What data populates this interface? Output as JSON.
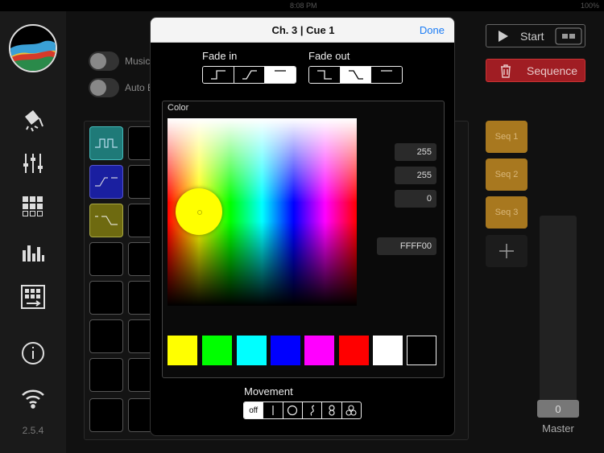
{
  "status": {
    "time": "8:08 PM",
    "battery": "100%"
  },
  "app": {
    "version": "2.5.4"
  },
  "main": {
    "music_toggle_label": "Music",
    "auto_toggle_label": "Auto B",
    "start_label": "Start",
    "sequence_label": "Sequence",
    "seq_buttons": [
      "Seq 1",
      "Seq 2",
      "Seq 3"
    ],
    "master_value": "0",
    "master_label": "Master"
  },
  "modal": {
    "title": "Ch. 3 | Cue 1",
    "done_label": "Done",
    "fade_in_label": "Fade in",
    "fade_out_label": "Fade out",
    "color_label": "Color",
    "rgb": {
      "r": "255",
      "g": "255",
      "b": "0"
    },
    "hex": "FFFF00",
    "swatches": [
      "#ffff00",
      "#00ff00",
      "#00ffff",
      "#0000ff",
      "#ff00ff",
      "#ff0000",
      "#ffffff",
      "#000000"
    ],
    "movement_label": "Movement",
    "movement_off": "off"
  },
  "colors": {
    "accent": "#1b7cf5",
    "sequence_red": "#a01d23",
    "seq_gold": "#a8781f",
    "cell_teal": "#1f7a78",
    "cell_blue": "#1a1fa0",
    "cell_olive": "#6e6a10"
  }
}
